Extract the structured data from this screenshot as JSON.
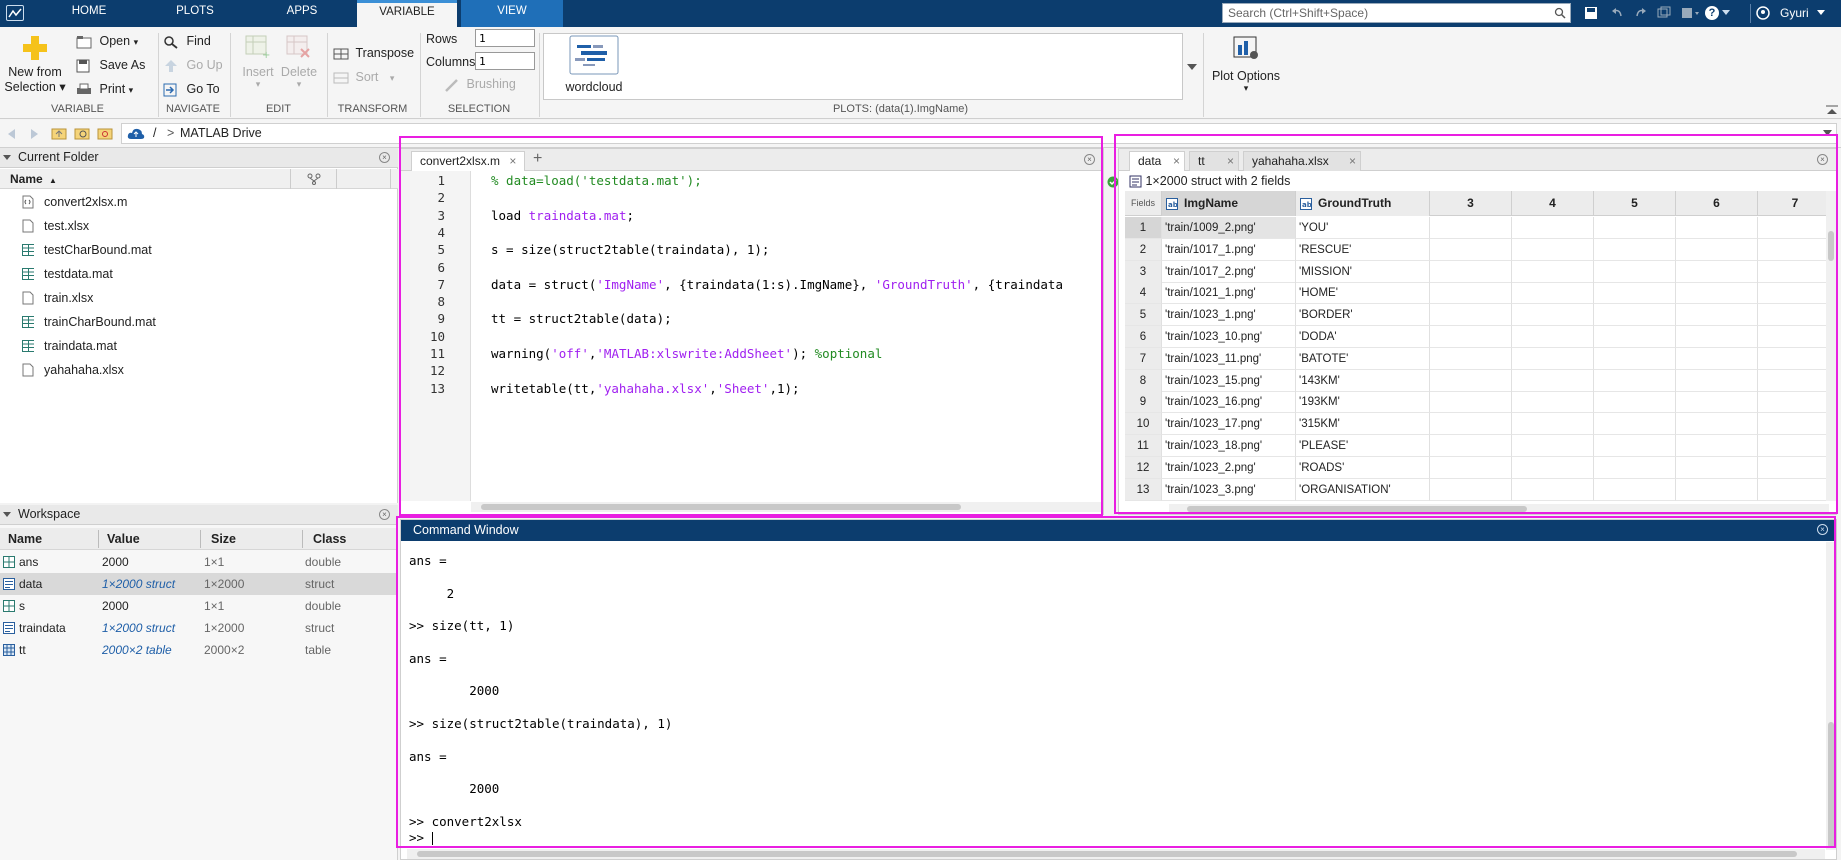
{
  "topbar": {
    "tabs": [
      "HOME",
      "PLOTS",
      "APPS",
      "VARIABLE",
      "VIEW"
    ],
    "active_tab": "VARIABLE",
    "search_placeholder": "Search (Ctrl+Shift+Space)",
    "user": "Gyuri",
    "help": "?"
  },
  "ribbon": {
    "variable": {
      "new_from_1": "New from",
      "new_from_2": "Selection",
      "open": "Open",
      "save_as": "Save As",
      "print": "Print",
      "group": "VARIABLE"
    },
    "navigate": {
      "find": "Find",
      "go_up": "Go Up",
      "go_to": "Go To",
      "group": "NAVIGATE"
    },
    "edit": {
      "insert": "Insert",
      "delete": "Delete",
      "group": "EDIT"
    },
    "transform": {
      "transpose": "Transpose",
      "sort": "Sort",
      "group": "TRANSFORM"
    },
    "selection": {
      "rows_label": "Rows",
      "rows_value": "1",
      "columns_label": "Columns",
      "columns_value": "1",
      "brushing": "Brushing",
      "group": "SELECTION"
    },
    "plots": {
      "gallery_item": "wordcloud",
      "group": "PLOTS: (data(1).ImgName)"
    },
    "plot_options": "Plot Options"
  },
  "address": {
    "sep": "/",
    "arrow": ">",
    "folder": "MATLAB Drive"
  },
  "current_folder": {
    "title": "Current Folder",
    "col_name": "Name",
    "sort_arrow": "▲",
    "files": [
      {
        "name": "convert2xlsx.m",
        "type": "script"
      },
      {
        "name": "test.xlsx",
        "type": "file"
      },
      {
        "name": "testCharBound.mat",
        "type": "mat"
      },
      {
        "name": "testdata.mat",
        "type": "mat"
      },
      {
        "name": "train.xlsx",
        "type": "file"
      },
      {
        "name": "trainCharBound.mat",
        "type": "mat"
      },
      {
        "name": "traindata.mat",
        "type": "mat"
      },
      {
        "name": "yahahaha.xlsx",
        "type": "file"
      }
    ]
  },
  "workspace": {
    "title": "Workspace",
    "columns": [
      "Name",
      "Value",
      "Size",
      "Class"
    ],
    "rows": [
      {
        "name": "ans",
        "value": "2000",
        "size": "1×1",
        "class": "double",
        "icon": "grid"
      },
      {
        "name": "data",
        "value": "1×2000 struct",
        "size": "1×2000",
        "class": "struct",
        "icon": "struct"
      },
      {
        "name": "s",
        "value": "2000",
        "size": "1×1",
        "class": "double",
        "icon": "grid"
      },
      {
        "name": "traindata",
        "value": "1×2000 struct",
        "size": "1×2000",
        "class": "struct",
        "icon": "struct"
      },
      {
        "name": "tt",
        "value": "2000×2 table",
        "size": "2000×2",
        "class": "table",
        "icon": "table"
      }
    ]
  },
  "editor": {
    "tab": "convert2xlsx.m",
    "add": "+",
    "lines": [
      [
        [
          "cm",
          "% data=load('testdata.mat');"
        ]
      ],
      [],
      [
        [
          "",
          "load "
        ],
        [
          "str",
          "traindata.mat"
        ],
        [
          "",
          ";"
        ]
      ],
      [],
      [
        [
          "",
          "s = size(struct2table(traindata), 1);"
        ]
      ],
      [],
      [
        [
          "",
          "data = struct("
        ],
        [
          "str",
          "'ImgName'"
        ],
        [
          "",
          ", {traindata(1:s).ImgName}, "
        ],
        [
          "str",
          "'GroundTruth'"
        ],
        [
          "",
          ", {traindata"
        ]
      ],
      [],
      [
        [
          "",
          "tt = struct2table(data);"
        ]
      ],
      [],
      [
        [
          "",
          "warning("
        ],
        [
          "str",
          "'off'"
        ],
        [
          "",
          ","
        ],
        [
          "str",
          "'MATLAB:xlswrite:AddSheet'"
        ],
        [
          "",
          "); "
        ],
        [
          "cm",
          "%optional"
        ]
      ],
      [],
      [
        [
          "",
          "writetable(tt,"
        ],
        [
          "str",
          "'yahahaha.xlsx'"
        ],
        [
          "",
          ","
        ],
        [
          "str",
          "'Sheet'"
        ],
        [
          "",
          ",1);"
        ]
      ]
    ]
  },
  "variables": {
    "tabs": [
      "data",
      "tt",
      "yahahaha.xlsx"
    ],
    "info": "1×2000 struct with 2 fields",
    "corner": "Fields",
    "columns": [
      "ImgName",
      "GroundTruth",
      "3",
      "4",
      "5",
      "6",
      "7"
    ],
    "rows": [
      [
        "1",
        "'train/1009_2.png'",
        "'YOU'"
      ],
      [
        "2",
        "'train/1017_1.png'",
        "'RESCUE'"
      ],
      [
        "3",
        "'train/1017_2.png'",
        "'MISSION'"
      ],
      [
        "4",
        "'train/1021_1.png'",
        "'HOME'"
      ],
      [
        "5",
        "'train/1023_1.png'",
        "'BORDER'"
      ],
      [
        "6",
        "'train/1023_10.png'",
        "'DODA'"
      ],
      [
        "7",
        "'train/1023_11.png'",
        "'BATOTE'"
      ],
      [
        "8",
        "'train/1023_15.png'",
        "'143KM'"
      ],
      [
        "9",
        "'train/1023_16.png'",
        "'193KM'"
      ],
      [
        "10",
        "'train/1023_17.png'",
        "'315KM'"
      ],
      [
        "11",
        "'train/1023_18.png'",
        "'PLEASE'"
      ],
      [
        "12",
        "'train/1023_2.png'",
        "'ROADS'"
      ],
      [
        "13",
        "'train/1023_3.png'",
        "'ORGANISATION'"
      ]
    ]
  },
  "command_window": {
    "title": "Command Window",
    "lines": [
      "ans =",
      "",
      "     2",
      "",
      ">> size(tt, 1)",
      "",
      "ans =",
      "",
      "        2000",
      "",
      ">> size(struct2table(traindata), 1)",
      "",
      "ans =",
      "",
      "        2000",
      "",
      ">> convert2xlsx"
    ],
    "prompt": ">> "
  },
  "colors": {
    "title_bar": "#0c3d6e",
    "highlight": "#e91ee1",
    "string": "#a020f0",
    "comment": "#228b22"
  }
}
